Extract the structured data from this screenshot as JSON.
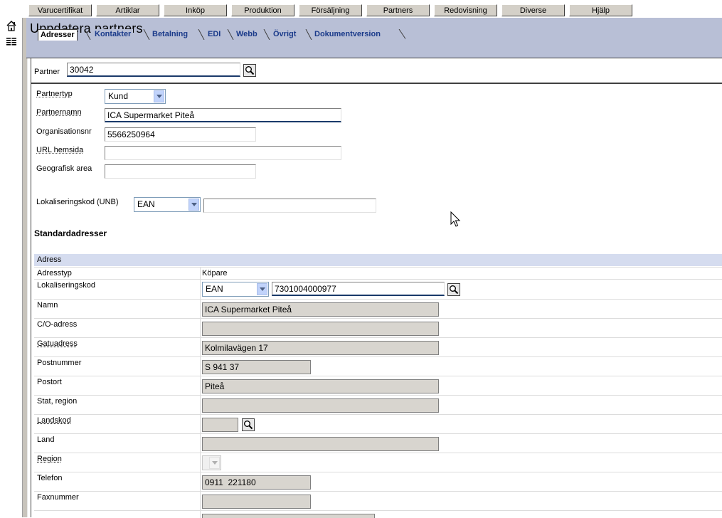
{
  "menu": {
    "items": [
      "Varucertifikat",
      "Artiklar",
      "Inköp",
      "Produktion",
      "Försäljning",
      "Partners",
      "Redovisning",
      "Diverse",
      "Hjälp"
    ]
  },
  "header": {
    "title": "Uppdatera partners",
    "tabs": [
      "Adresser",
      "Kontakter",
      "Betalning",
      "EDI",
      "Webb",
      "Övrigt",
      "Dokumentversion"
    ],
    "active_tab": "Adresser"
  },
  "partner": {
    "label": "Partner",
    "value": "30042"
  },
  "form": {
    "partnertyp_label": "Partnertyp",
    "partnertyp_value": "Kund",
    "partnernamn_label": "Partnernamn",
    "partnernamn_value": "ICA Supermarket Piteå",
    "orgnr_label": "Organisationsnr",
    "orgnr_value": "5566250964",
    "url_label": "URL hemsida",
    "url_value": "",
    "geo_label": "Geografisk area",
    "geo_value": "",
    "lokkod_label": "Lokaliseringskod (UNB)",
    "lokkod_type": "EAN",
    "lokkod_value": ""
  },
  "standard": {
    "heading": "Standardadresser",
    "table_header": "Adress",
    "adresstyp_label": "Adresstyp",
    "adresstyp_value": "Köpare",
    "lokkod_label": "Lokaliseringskod",
    "lokkod_type": "EAN",
    "lokkod_value": "7301004000977",
    "namn_label": "Namn",
    "namn_value": "ICA Supermarket Piteå",
    "co_label": "C/O-adress",
    "co_value": "",
    "gata_label": "Gatuadress",
    "gata_value": "Kolmilavägen 17",
    "postnr_label": "Postnummer",
    "postnr_value": "S 941 37",
    "postort_label": "Postort",
    "postort_value": "Piteå",
    "stat_label": "Stat, region",
    "stat_value": "",
    "landskod_label": "Landskod",
    "landskod_value": "",
    "land_label": "Land",
    "land_value": "",
    "region_label": "Region",
    "region_value": "",
    "telefon_label": "Telefon",
    "telefon_value": "0911  221180",
    "fax_label": "Faxnummer",
    "fax_value": ""
  }
}
